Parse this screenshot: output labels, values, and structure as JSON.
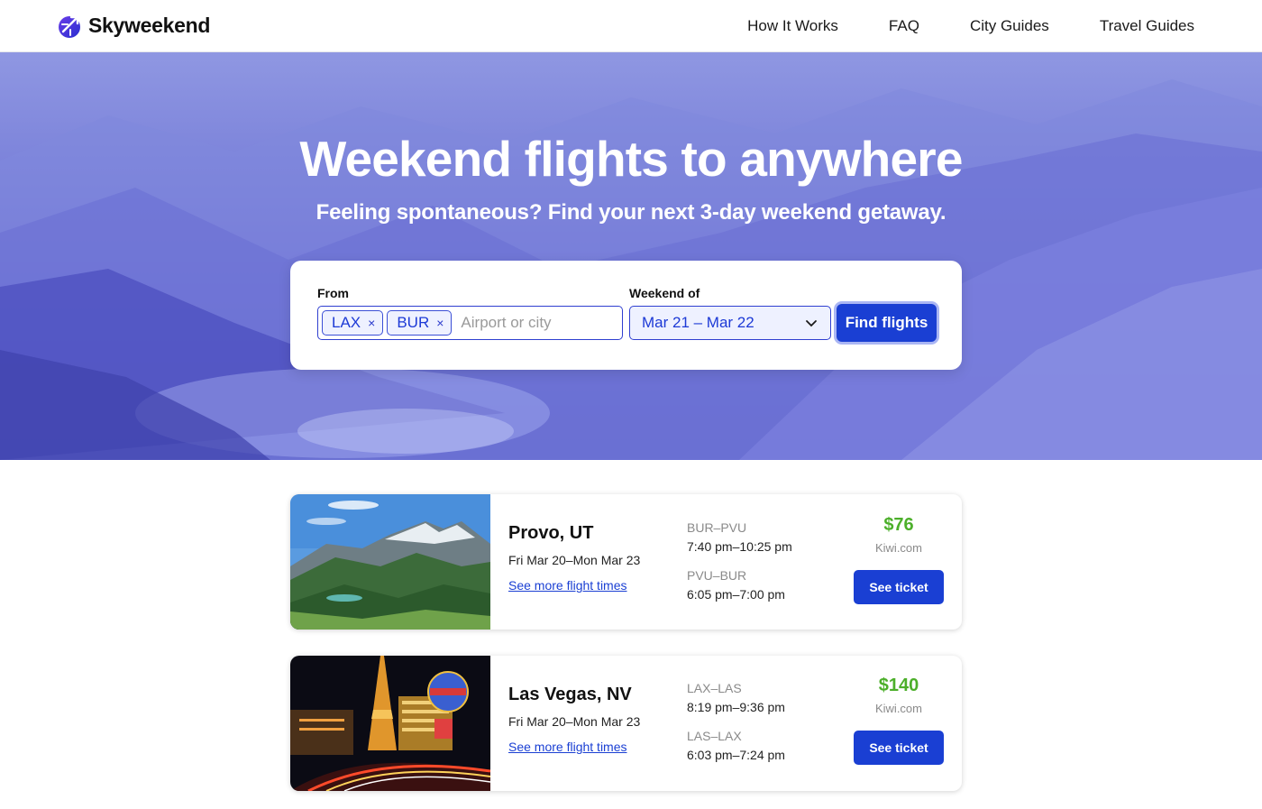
{
  "header": {
    "brand": "Skyweekend",
    "nav": [
      "How It Works",
      "FAQ",
      "City Guides",
      "Travel Guides"
    ]
  },
  "hero": {
    "title": "Weekend flights to anywhere",
    "subtitle": "Feeling spontaneous? Find your next 3-day weekend getaway."
  },
  "search": {
    "from_label": "From",
    "chips": [
      "LAX",
      "BUR"
    ],
    "chip_remove": "×",
    "placeholder": "Airport or city",
    "weekend_label": "Weekend of",
    "weekend_value": "Mar 21 – Mar 22",
    "button": "Find flights"
  },
  "results": [
    {
      "city": "Provo, UT",
      "dates": "Fri Mar 20–Mon Mar 23",
      "more_link": "See more flight times",
      "outbound_route": "BUR–PVU",
      "outbound_time": "7:40 pm–10:25 pm",
      "return_route": "PVU–BUR",
      "return_time": "6:05 pm–7:00 pm",
      "price": "$76",
      "source": "Kiwi.com",
      "button": "See ticket"
    },
    {
      "city": "Las Vegas, NV",
      "dates": "Fri Mar 20–Mon Mar 23",
      "more_link": "See more flight times",
      "outbound_route": "LAX–LAS",
      "outbound_time": "8:19 pm–9:36 pm",
      "return_route": "LAS–LAX",
      "return_time": "6:03 pm–7:24 pm",
      "price": "$140",
      "source": "Kiwi.com",
      "button": "See ticket"
    }
  ],
  "colors": {
    "accent": "#1a3fd3",
    "price": "#4caf2a",
    "hero": "#6e70d6"
  }
}
